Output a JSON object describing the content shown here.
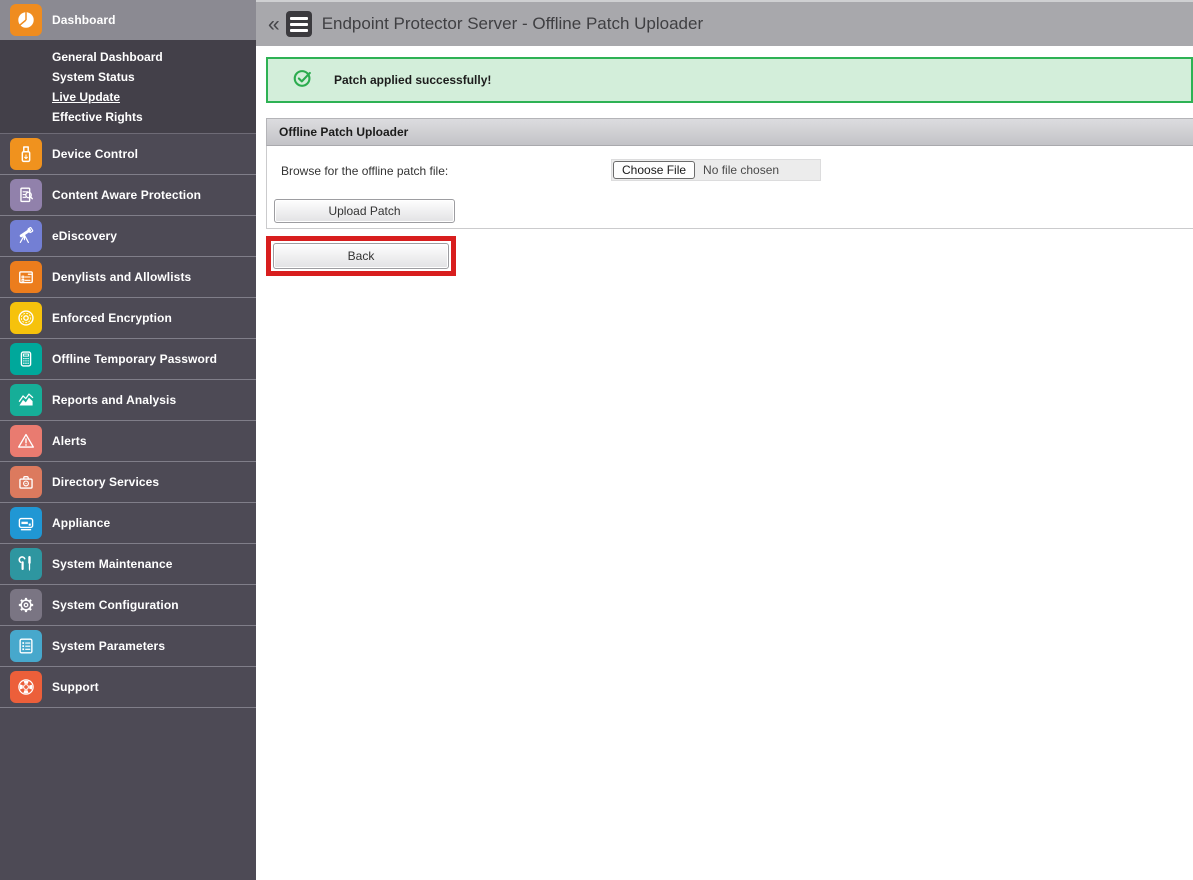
{
  "colors": {
    "sidebar_bg": "#4d4a55",
    "sidebar_active_bg": "#8b8a92",
    "submenu_bg": "#434049",
    "header_bg": "#a8a8ac",
    "success_green": "#2eb254",
    "success_bg": "#d3eeda",
    "annotation_red": "#d81e1e"
  },
  "sidebar": {
    "active_section": "Dashboard",
    "active_submenu": "Live Update",
    "sections": [
      {
        "label": "Dashboard",
        "icon": "pie-chart-icon",
        "color": "#ef8c1f",
        "submenu": [
          "General Dashboard",
          "System Status",
          "Live Update",
          "Effective Rights"
        ]
      },
      {
        "label": "Device Control",
        "icon": "usb-drive-icon",
        "color": "#f0921e"
      },
      {
        "label": "Content Aware Protection",
        "icon": "document-scan-icon",
        "color": "#9181ab"
      },
      {
        "label": "eDiscovery",
        "icon": "telescope-icon",
        "color": "#737fd4"
      },
      {
        "label": "Denylists and Allowlists",
        "icon": "list-window-icon",
        "color": "#ec7d1d"
      },
      {
        "label": "Enforced Encryption",
        "icon": "disc-icon",
        "color": "#f6c20c"
      },
      {
        "label": "Offline Temporary Password",
        "icon": "calculator-icon",
        "color": "#00a89b"
      },
      {
        "label": "Reports and Analysis",
        "icon": "area-chart-icon",
        "color": "#16ae98"
      },
      {
        "label": "Alerts",
        "icon": "warning-triangle-icon",
        "color": "#e97b70"
      },
      {
        "label": "Directory Services",
        "icon": "briefcase-icon",
        "color": "#dc7a5e"
      },
      {
        "label": "Appliance",
        "icon": "server-icon",
        "color": "#2097d4"
      },
      {
        "label": "System Maintenance",
        "icon": "tools-icon",
        "color": "#2e96a0"
      },
      {
        "label": "System Configuration",
        "icon": "gear-icon",
        "color": "#7a7583"
      },
      {
        "label": "System Parameters",
        "icon": "checklist-icon",
        "color": "#47a8cc"
      },
      {
        "label": "Support",
        "icon": "lifebuoy-icon",
        "color": "#ec5f3a"
      }
    ]
  },
  "header": {
    "collapse_glyph": "«",
    "menu_icon": "hamburger-icon",
    "title": "Endpoint Protector Server - Offline Patch Uploader"
  },
  "alert": {
    "icon": "check-circle-icon",
    "message": "Patch applied successfully!"
  },
  "panel": {
    "title": "Offline Patch Uploader",
    "browse_label": "Browse for the offline patch file:",
    "choose_file_button": "Choose File",
    "file_status": "No file chosen",
    "upload_button": "Upload Patch"
  },
  "back_button": "Back"
}
